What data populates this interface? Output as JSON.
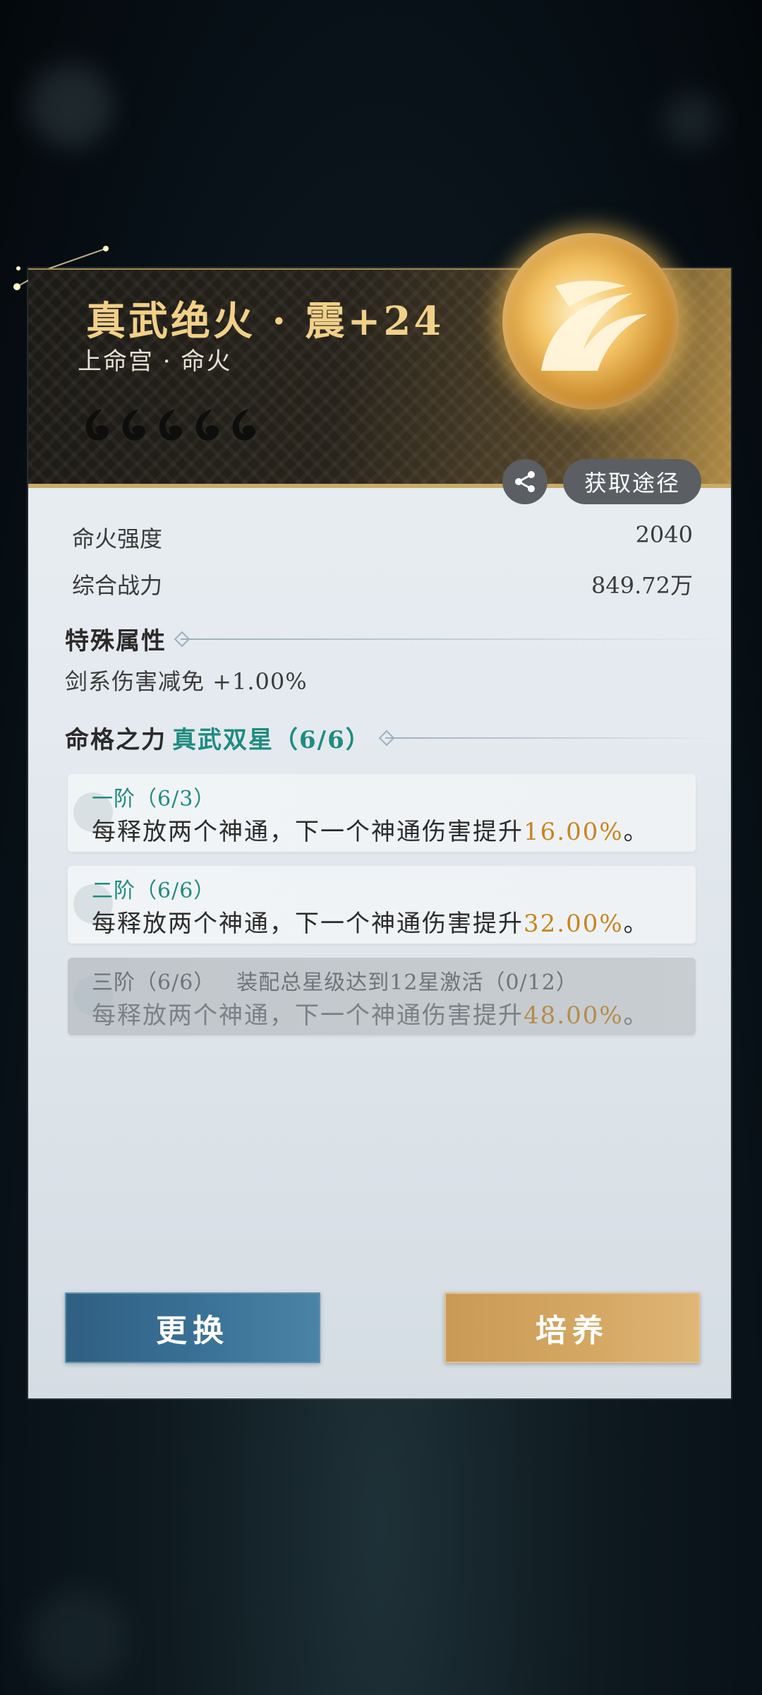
{
  "header": {
    "title": "真武绝火 · 震+24",
    "subtitle": "上命宫 · 命火",
    "star_icons": [
      "fire-star-icon",
      "fire-star-icon",
      "fire-star-icon",
      "fire-star-icon",
      "fire-star-icon"
    ]
  },
  "actions": {
    "share_icon": "share-icon",
    "source_label": "获取途径"
  },
  "stats": [
    {
      "label": "命火强度",
      "value": "2040"
    },
    {
      "label": "综合战力",
      "value": "849.72万"
    }
  ],
  "special": {
    "title": "特殊属性",
    "text": "剑系伤害减免 +1.00%"
  },
  "fate": {
    "title_prefix": "命格之力",
    "title_accent": "真武双星（6/6）",
    "tiers": [
      {
        "head": "一阶（6/3）",
        "requirement": "",
        "desc": "每释放两个神通，下一个神通伤害提升",
        "pct": "16.00%",
        "end": "。"
      },
      {
        "head": "二阶（6/6）",
        "requirement": "",
        "desc": "每释放两个神通，下一个神通伤害提升",
        "pct": "32.00%",
        "end": "。"
      },
      {
        "head": "三阶（6/6）",
        "requirement": "装配总星级达到12星激活（0/12）",
        "desc": "每释放两个神通，下一个神通伤害提升",
        "pct": "48.00%",
        "end": "。"
      }
    ]
  },
  "buttons": {
    "change": "更换",
    "train": "培养"
  },
  "colors": {
    "title_gold": "#f1d088",
    "accent_teal": "#1f8b80",
    "pct_orange": "#c8841e",
    "change_blue": "#3c7398",
    "train_gold": "#d5a864"
  }
}
